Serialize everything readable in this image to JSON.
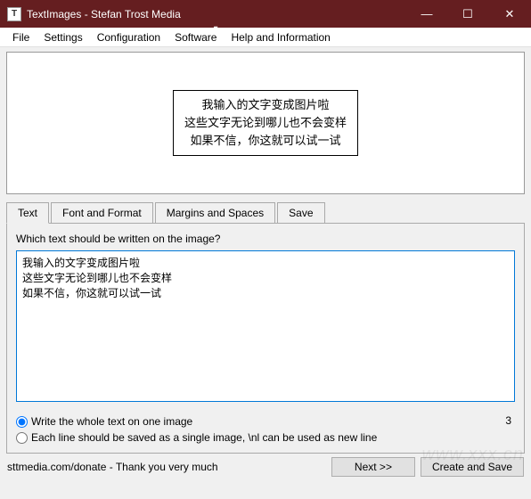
{
  "titlebar": {
    "icon_letter": "T",
    "title": "TextImages - Stefan Trost Media",
    "min": "—",
    "max": "☐",
    "close": "✕"
  },
  "menu": {
    "file": "File",
    "settings": "Settings",
    "configuration": "Configuration",
    "software": "Software",
    "help": "Help and Information"
  },
  "preview": {
    "line1": "我输入的文字变成图片啦",
    "line2": "这些文字无论到哪儿也不会变样",
    "line3": "如果不信，你这就可以试一试"
  },
  "tabs": {
    "text": "Text",
    "font": "Font and Format",
    "margins": "Margins and Spaces",
    "save": "Save"
  },
  "panel": {
    "question": "Which text should be written on the image?",
    "input_text": "我输入的文字变成图片啦\n这些文字无论到哪儿也不会变样\n如果不信，你这就可以试一试",
    "radio1": "Write the whole text on one image",
    "radio2": "Each line should be saved as a single image, \\nl can be used as new line",
    "count": "3"
  },
  "footer": {
    "text": "sttmedia.com/donate - Thank you very much",
    "next": "Next >>",
    "create": "Create and Save"
  },
  "watermark": "www.xxx.cn"
}
